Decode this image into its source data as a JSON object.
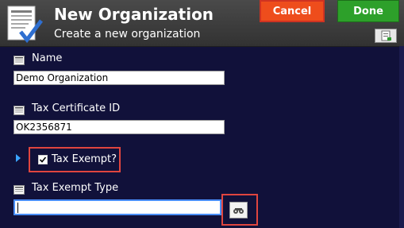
{
  "header": {
    "title": "New Organization",
    "subtitle": "Create a new organization",
    "cancel_label": "Cancel",
    "done_label": "Done",
    "icon": "organization-form-icon"
  },
  "fields": {
    "name": {
      "label": "Name",
      "value": "Demo Organization"
    },
    "tax_certificate_id": {
      "label": "Tax Certificate ID",
      "value": "OK2356871"
    },
    "tax_exempt": {
      "label": "Tax Exempt?",
      "checked": true
    },
    "tax_exempt_type": {
      "label": "Tax Exempt Type",
      "value": ""
    }
  },
  "colors": {
    "background": "#11113a",
    "header": "#3c3c3c",
    "cancel": "#ee4d1c",
    "done": "#2da02a",
    "highlight": "#e0453f",
    "focus": "#4a8fff"
  }
}
